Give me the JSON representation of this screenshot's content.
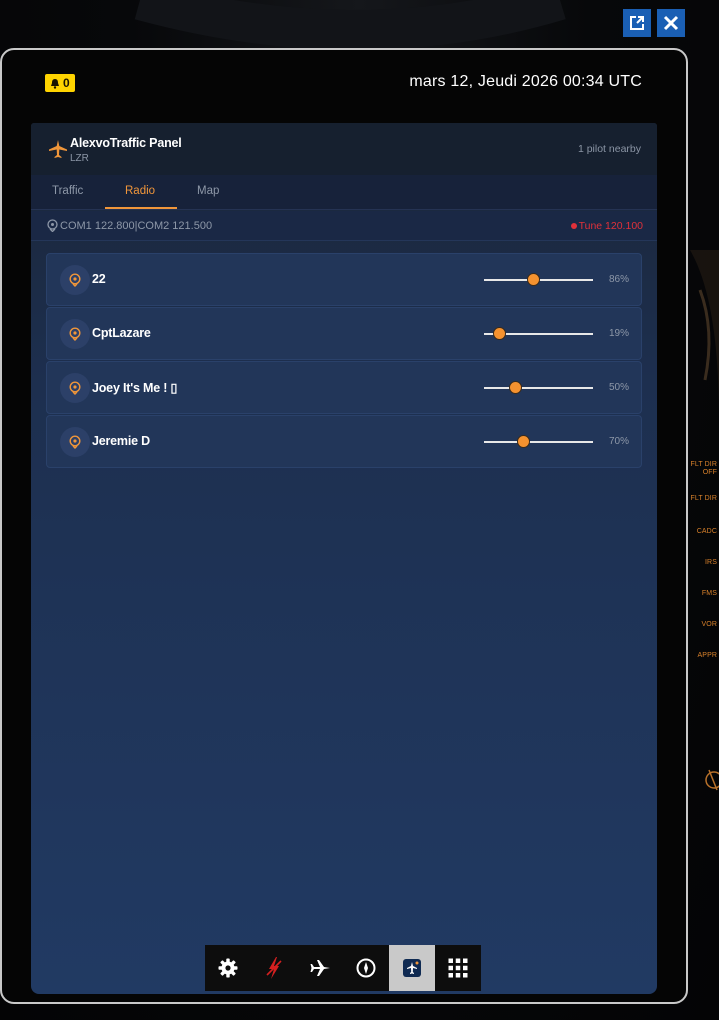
{
  "window": {
    "popout_icon": "external-link-icon",
    "close_icon": "close-icon"
  },
  "tablet": {
    "notifications_count": "0",
    "datetime": "mars 12, Jeudi 2026 00:34 UTC"
  },
  "panel": {
    "title": "AlexvoTraffic Panel",
    "subtitle": "LZR",
    "pilots_nearby": "1 pilot nearby",
    "tabs": [
      {
        "label": "Traffic"
      },
      {
        "label": "Radio"
      },
      {
        "label": "Map"
      }
    ],
    "active_tab": "Radio",
    "com_info": "COM1 122.800|COM2 121.500",
    "tune_label": "Tune 120.100",
    "accent_color": "#f0963a",
    "tune_color": "#e0313a"
  },
  "pilots": [
    {
      "name": "22",
      "volume_pct": "86%",
      "volume": 0.45
    },
    {
      "name": "CptLazare",
      "volume_pct": "19%",
      "volume": 0.14
    },
    {
      "name": "Joey It's Me ! ▯",
      "volume_pct": "50%",
      "volume": 0.29
    },
    {
      "name": "Jeremie D",
      "volume_pct": "70%",
      "volume": 0.36
    }
  ],
  "cockpit_labels": [
    "FLT DIR OFF",
    "FLT DIR",
    "CADC",
    "IRS",
    "FMS",
    "VOR",
    "APPR"
  ],
  "toolbar": {
    "items": [
      {
        "icon": "gear-icon",
        "active": false
      },
      {
        "icon": "lightning-icon",
        "active": false
      },
      {
        "icon": "airplane-icon",
        "active": false
      },
      {
        "icon": "compass-icon",
        "active": false
      },
      {
        "icon": "traffic-panel-icon",
        "active": true
      },
      {
        "icon": "grid-icon",
        "active": false
      }
    ]
  }
}
